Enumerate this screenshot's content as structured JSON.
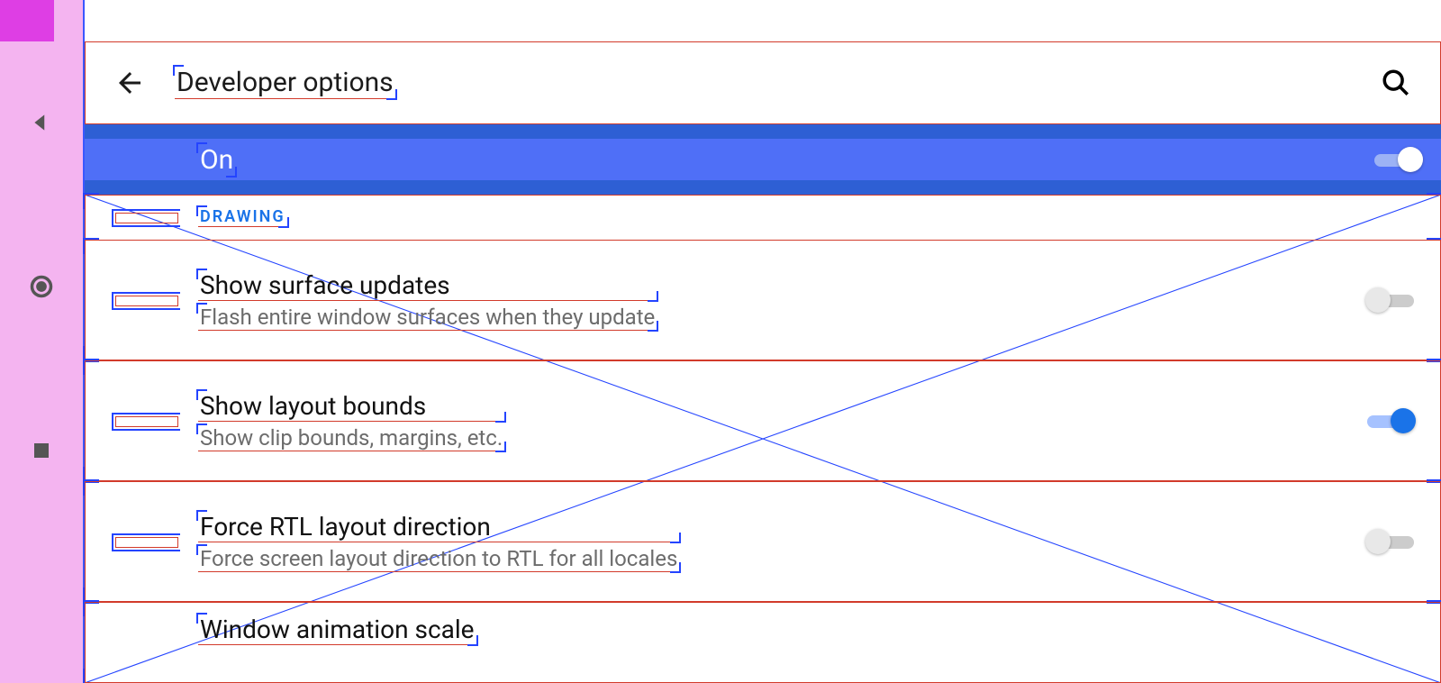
{
  "sysnav": {
    "buttons": [
      "back",
      "home",
      "recents"
    ]
  },
  "appbar": {
    "title": "Developer options"
  },
  "master_toggle": {
    "label": "On",
    "state": "on"
  },
  "section": {
    "header": "DRAWING"
  },
  "rows": [
    {
      "title": "Show surface updates",
      "subtitle": "Flash entire window surfaces when they update",
      "toggle": "off"
    },
    {
      "title": "Show layout bounds",
      "subtitle": "Show clip bounds, margins, etc.",
      "toggle": "on"
    },
    {
      "title": "Force RTL layout direction",
      "subtitle": "Force screen layout direction to RTL for all locales",
      "toggle": "off"
    },
    {
      "title": "Window animation scale",
      "subtitle": "",
      "toggle": null
    }
  ]
}
